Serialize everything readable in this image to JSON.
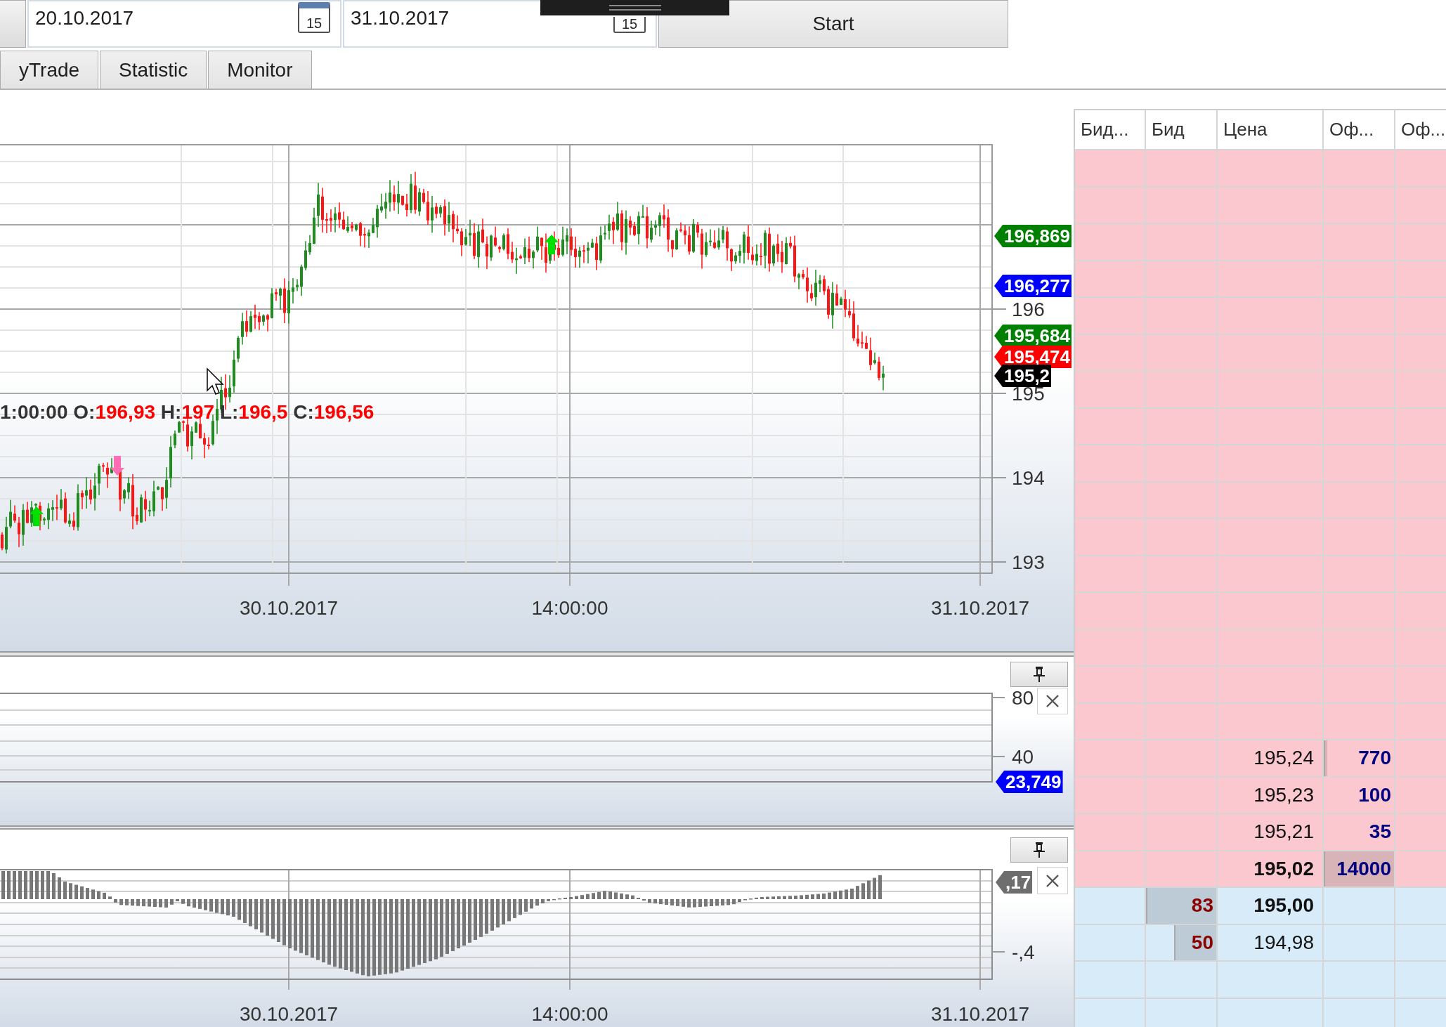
{
  "toolbar": {
    "date_fields": [
      {
        "value": "20.10.2017",
        "calendar_day": "15"
      },
      {
        "value": "31.10.2017",
        "calendar_day": "15"
      }
    ],
    "start_button": "Start"
  },
  "tabs": [
    {
      "label": "yTrade",
      "selected": false
    },
    {
      "label": "Statistic",
      "selected": false
    },
    {
      "label": "Monitor",
      "selected": false
    }
  ],
  "price_chart": {
    "ohlc_legend": {
      "time": "1:00:00",
      "fields": [
        {
          "label": "O:",
          "value": "196,93"
        },
        {
          "label": "H:",
          "value": "197"
        },
        {
          "label": "L:",
          "value": "196,5"
        },
        {
          "label": "C:",
          "value": "196,56"
        }
      ]
    },
    "y_ticks": [
      "196",
      "195",
      "194",
      "193"
    ],
    "x_ticks": [
      "30.10.2017",
      "14:00:00",
      "31.10.2017"
    ],
    "price_tags": [
      {
        "text": "196,869",
        "color": "#008000"
      },
      {
        "text": "196,277",
        "color": "#0000ff"
      },
      {
        "text": "195,684",
        "color": "#008000"
      },
      {
        "text": "195,474",
        "color": "#ff0000"
      },
      {
        "text": "195,2",
        "color": "#000000"
      }
    ]
  },
  "indicator_panes": [
    {
      "y_ticks": [
        "80",
        "40"
      ],
      "value_tag": "23,749"
    },
    {
      "y_ticks": [
        "-,4"
      ],
      "value_tag": ",17",
      "x_ticks": [
        "30.10.2017",
        "14:00:00",
        "31.10.2017"
      ]
    }
  ],
  "order_book": {
    "columns": [
      "Бид...",
      "Бид",
      "Цена",
      "Оф...",
      "Оф..."
    ],
    "rows": [
      {
        "kind": "ask"
      },
      {
        "kind": "ask"
      },
      {
        "kind": "ask"
      },
      {
        "kind": "ask"
      },
      {
        "kind": "ask"
      },
      {
        "kind": "ask"
      },
      {
        "kind": "ask"
      },
      {
        "kind": "ask"
      },
      {
        "kind": "ask"
      },
      {
        "kind": "ask"
      },
      {
        "kind": "ask"
      },
      {
        "kind": "ask"
      },
      {
        "kind": "ask"
      },
      {
        "kind": "ask"
      },
      {
        "kind": "ask"
      },
      {
        "kind": "ask"
      },
      {
        "kind": "ask",
        "price": "195,24",
        "best": false,
        "offer": {
          "volume": "770",
          "level": 0.05
        }
      },
      {
        "kind": "ask",
        "price": "195,23",
        "best": false,
        "offer": {
          "volume": "100"
        }
      },
      {
        "kind": "ask",
        "price": "195,21",
        "best": false,
        "offer": {
          "volume": "35"
        }
      },
      {
        "kind": "ask",
        "price": "195,02",
        "best": true,
        "offer": {
          "volume": "14000",
          "level": 1
        }
      },
      {
        "kind": "bid",
        "price": "195,00",
        "best": true,
        "bid": {
          "volume": "83",
          "level": 1
        }
      },
      {
        "kind": "bid",
        "price": "194,98",
        "best": false,
        "bid": {
          "volume": "50",
          "level": 0.6
        }
      },
      {
        "kind": "bid"
      },
      {
        "kind": "bid"
      }
    ]
  }
}
